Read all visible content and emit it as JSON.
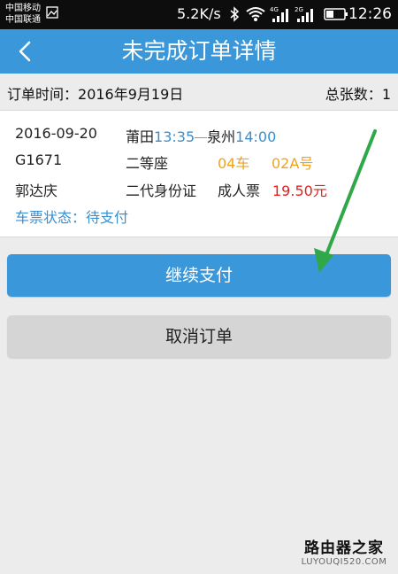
{
  "status_bar": {
    "carrier_1": "中国移动",
    "carrier_2": "中国联通",
    "speed": "5.2K/s",
    "net_4g": "4G",
    "net_2g": "2G",
    "time": "12:26"
  },
  "header": {
    "title": "未完成订单详情"
  },
  "summary": {
    "order_time_label": "订单时间：",
    "order_time_value": "2016年9月19日",
    "ticket_count_label": "总张数：",
    "ticket_count_value": "1"
  },
  "ticket": {
    "date": "2016-09-20",
    "from_station": "莆田",
    "depart_time": "13:35",
    "to_station": "泉州",
    "arrive_time": "14:00",
    "train_no": "G1671",
    "seat_class": "二等座",
    "car": "04车",
    "seat": "02A号",
    "passenger": "郭达庆",
    "id_type": "二代身份证",
    "ticket_type": "成人票",
    "price": "19.50元",
    "status_label": "车票状态：",
    "status_value": "待支付"
  },
  "actions": {
    "pay_label": "继续支付",
    "cancel_label": "取消订单"
  },
  "watermark": {
    "cn": "路由器之家",
    "en": "LUYOUQI520.COM"
  },
  "colors": {
    "accent": "#3a97d9",
    "orange": "#f0a31a",
    "red": "#e0221e",
    "annotation_arrow": "#2fa84a"
  }
}
